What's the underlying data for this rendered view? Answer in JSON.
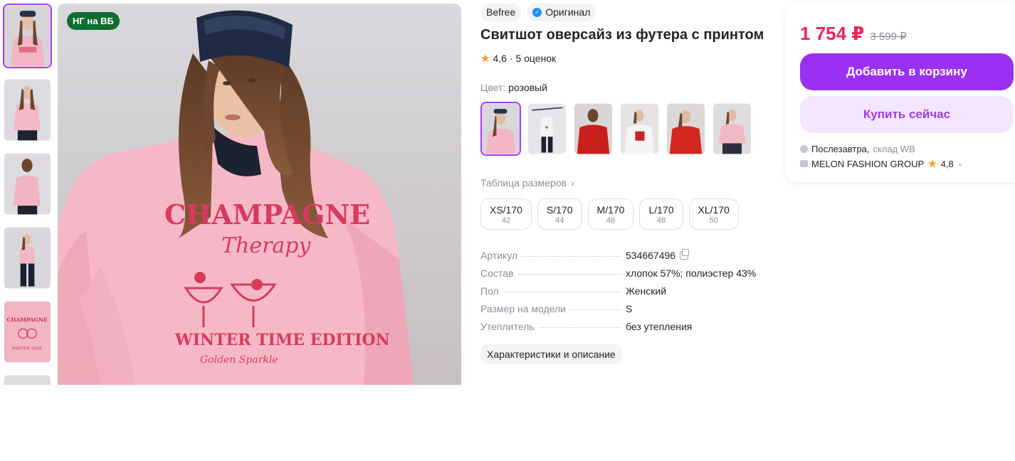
{
  "gallery": {
    "promo_badge": "НГ на ВБ",
    "thumbnails": [
      "photo-1",
      "photo-2",
      "photo-3",
      "photo-4",
      "photo-5",
      "photo-6"
    ],
    "active_index": 0
  },
  "product": {
    "brand": "Befree",
    "original_label": "Оригинал",
    "title": "Свитшот оверсайз из футера с принтом",
    "rating": "4,6",
    "reviews": "· 5 оценок",
    "color_label": "Цвет:",
    "color_value": "розовый",
    "size_table_label": "Таблица размеров",
    "sizes": [
      {
        "label": "XS/170",
        "ru": "42"
      },
      {
        "label": "S/170",
        "ru": "44"
      },
      {
        "label": "M/170",
        "ru": "46"
      },
      {
        "label": "L/170",
        "ru": "48"
      },
      {
        "label": "XL/170",
        "ru": "50"
      }
    ],
    "specs": [
      {
        "key": "Артикул",
        "value": "534667496"
      },
      {
        "key": "Состав",
        "value": "хлопок 57%; полиэстер 43%"
      },
      {
        "key": "Пол",
        "value": "Женский"
      },
      {
        "key": "Размер на модели",
        "value": "S"
      },
      {
        "key": "Утеплитель",
        "value": "без утепления"
      }
    ],
    "description_button": "Характеристики и описание"
  },
  "buy": {
    "price": "1 754 ₽",
    "old_price": "3 599 ₽",
    "add_to_cart": "Добавить в корзину",
    "buy_now": "Купить сейчас",
    "delivery": "Послезавтра,",
    "warehouse": "склад WB",
    "seller": "MELON FASHION GROUP",
    "seller_rating": "4,8"
  },
  "colors": {
    "accent": "#9b2ff2",
    "price": "#f0245c",
    "badge_green": "#0d6e2f"
  }
}
